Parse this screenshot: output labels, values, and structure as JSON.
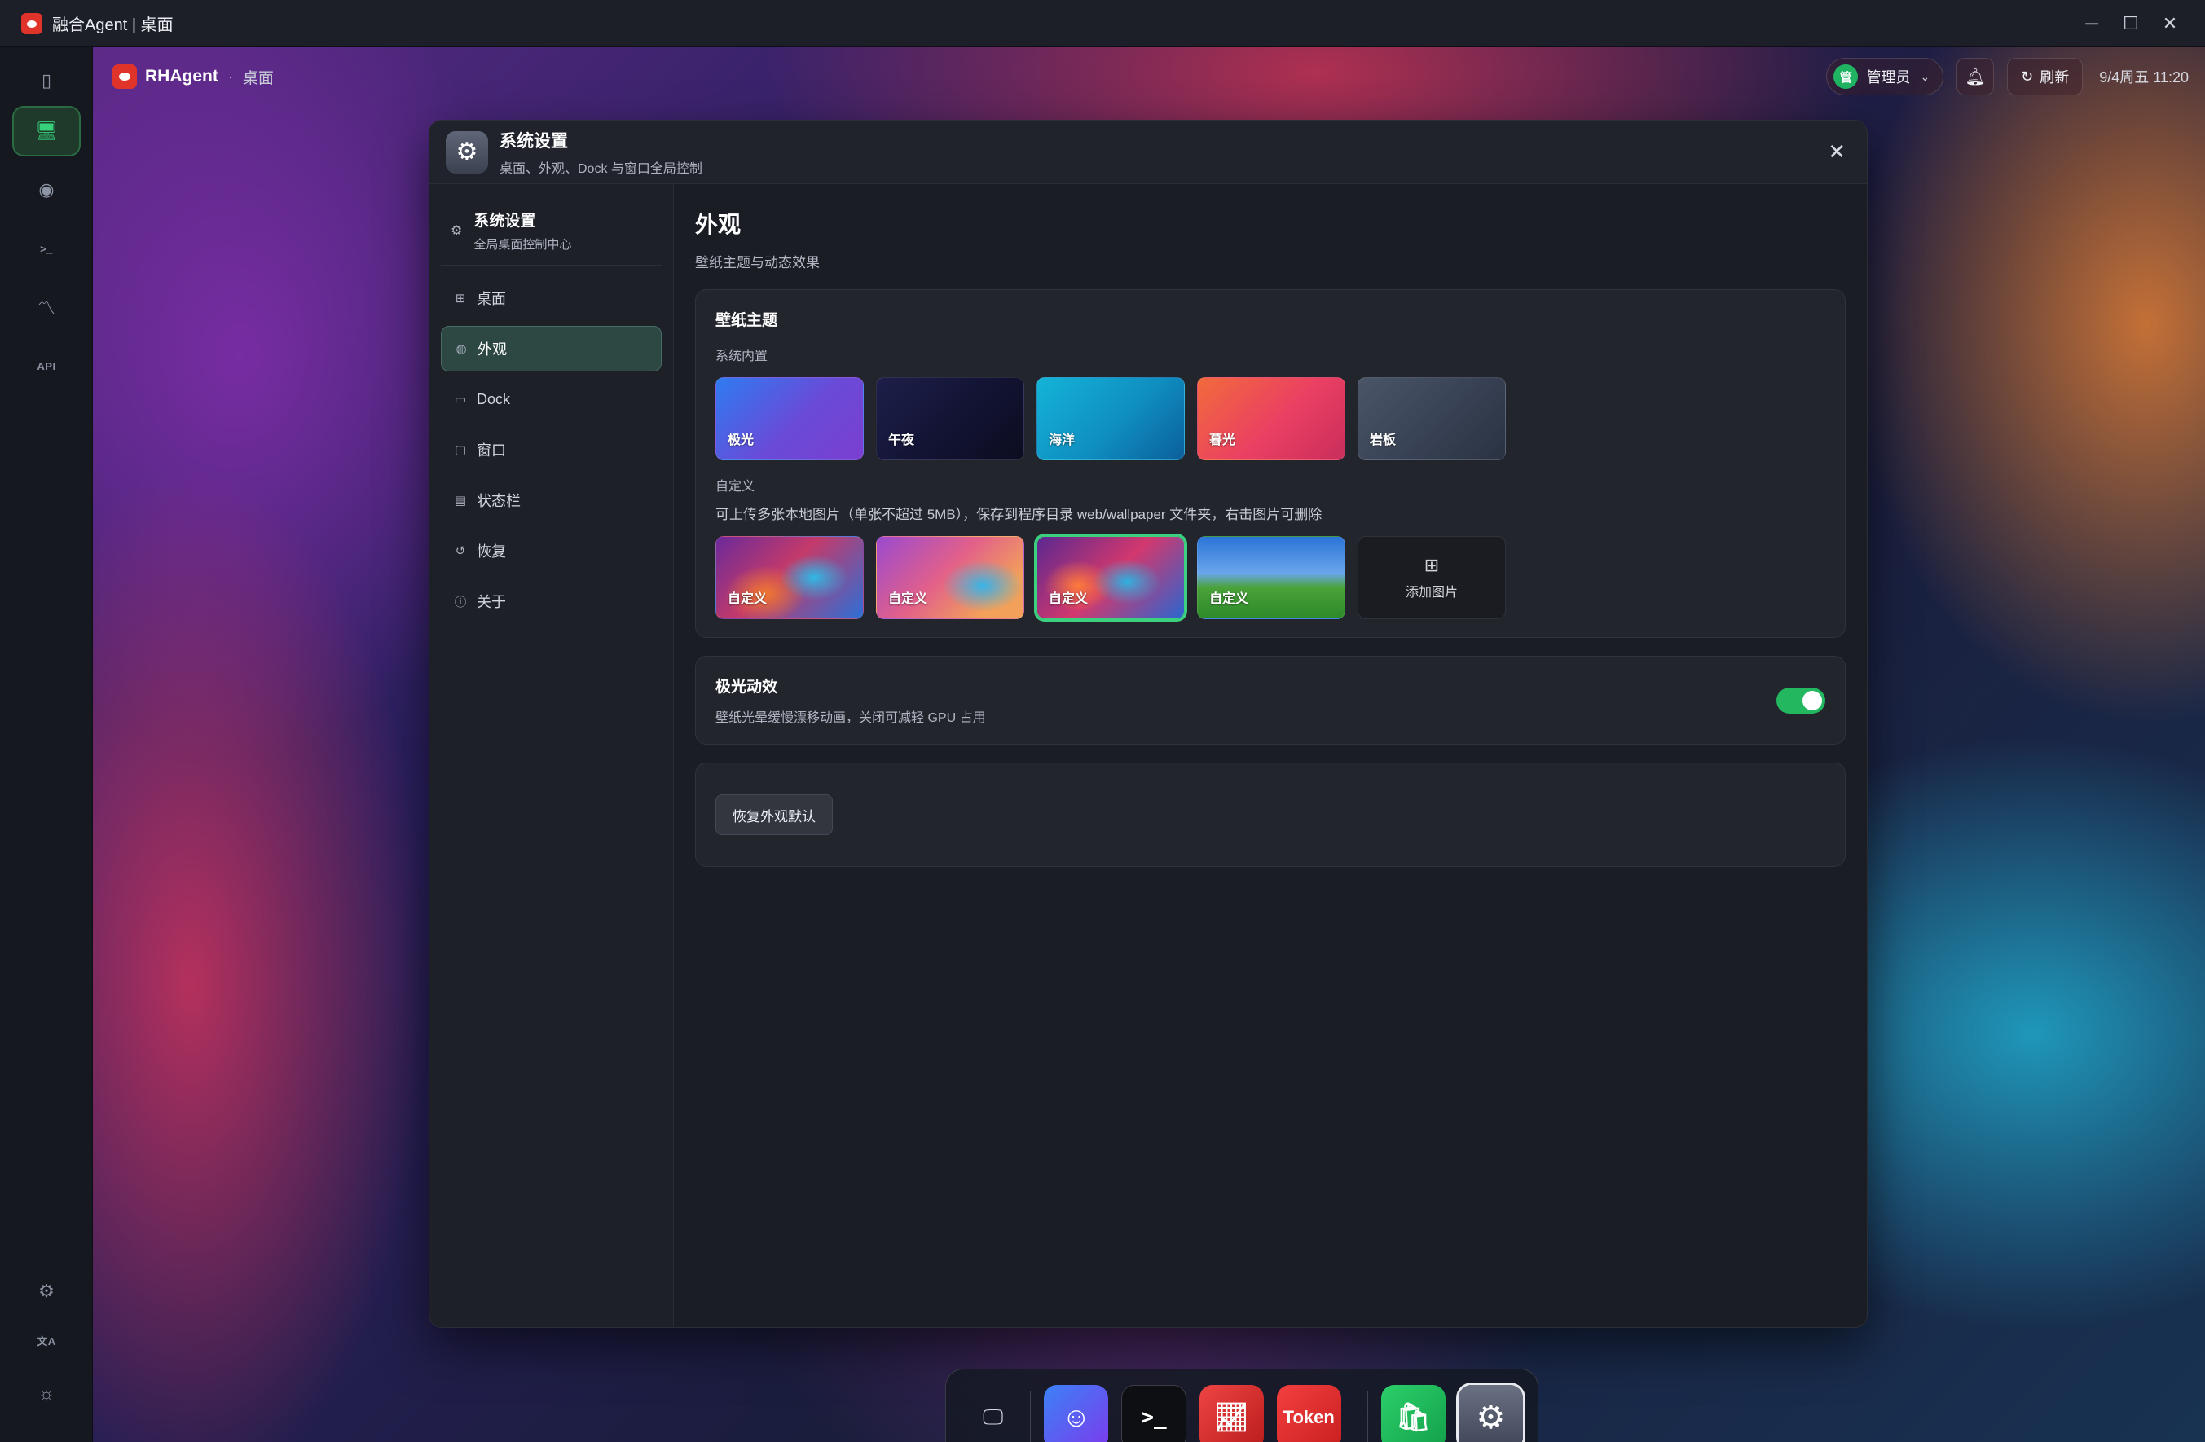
{
  "window": {
    "title": "融合Agent | 桌面",
    "controls": {
      "minimize": "─",
      "maximize": "☐",
      "close": "✕"
    }
  },
  "rail": {
    "items": [
      {
        "name": "sidebar-toggle-icon",
        "glyph": "▯"
      },
      {
        "name": "desktop-icon",
        "glyph": "🖥"
      },
      {
        "name": "robot-icon",
        "glyph": "◉"
      },
      {
        "name": "terminal-icon",
        "glyph": ">_"
      },
      {
        "name": "chart-line-icon",
        "glyph": "〽"
      },
      {
        "name": "api-icon",
        "glyph": "API"
      }
    ],
    "bottom": [
      {
        "name": "gear-icon",
        "glyph": "⚙"
      },
      {
        "name": "translate-icon",
        "glyph": "文A"
      },
      {
        "name": "sun-icon",
        "glyph": "☼"
      }
    ]
  },
  "topbar": {
    "brand": "RHAgent",
    "separator": "·",
    "crumb": "桌面",
    "user": {
      "avatar": "管",
      "name": "管理员"
    },
    "refresh_label": "刷新",
    "clock": "9/4周五 11:20"
  },
  "modal": {
    "title": "系统设置",
    "subtitle": "桌面、外观、Dock 与窗口全局控制",
    "sidebar": {
      "title": "系统设置",
      "subtitle": "全局桌面控制中心",
      "items": [
        {
          "label": "桌面",
          "icon": "grid-icon",
          "glyph": "⊞"
        },
        {
          "label": "外观",
          "icon": "palette-icon",
          "glyph": "◍"
        },
        {
          "label": "Dock",
          "icon": "dock-icon",
          "glyph": "▭"
        },
        {
          "label": "窗口",
          "icon": "window-icon",
          "glyph": "▢"
        },
        {
          "label": "状态栏",
          "icon": "statusbar-icon",
          "glyph": "▤"
        },
        {
          "label": "恢复",
          "icon": "restore-icon",
          "glyph": "↺"
        },
        {
          "label": "关于",
          "icon": "info-icon",
          "glyph": "ⓘ"
        }
      ],
      "active": "外观"
    },
    "page": {
      "title": "外观",
      "subtitle": "壁纸主题与动态效果",
      "wallpaper_card": {
        "title": "壁纸主题",
        "builtin_label": "系统内置",
        "builtin": [
          "极光",
          "午夜",
          "海洋",
          "暮光",
          "岩板"
        ],
        "custom_label": "自定义",
        "custom_desc": "可上传多张本地图片（单张不超过 5MB），保存到程序目录 web/wallpaper 文件夹，右击图片可删除",
        "custom": [
          "自定义",
          "自定义",
          "自定义",
          "自定义"
        ],
        "custom_selected_index": 2,
        "add_label": "添加图片"
      },
      "aurora_card": {
        "title": "极光动效",
        "desc": "壁纸光晕缓慢漂移动画，关闭可减轻 GPU 占用",
        "enabled": true
      },
      "reset_label": "恢复外观默认"
    }
  },
  "dock": {
    "apps": [
      "chat-bot",
      "terminal",
      "stock-chart",
      "token",
      "store",
      "settings"
    ],
    "token_label": "Token"
  },
  "colors": {
    "accent_green": "#23b85f",
    "active_nav_bg": "#2d4743",
    "brand_red": "#e0342b"
  }
}
